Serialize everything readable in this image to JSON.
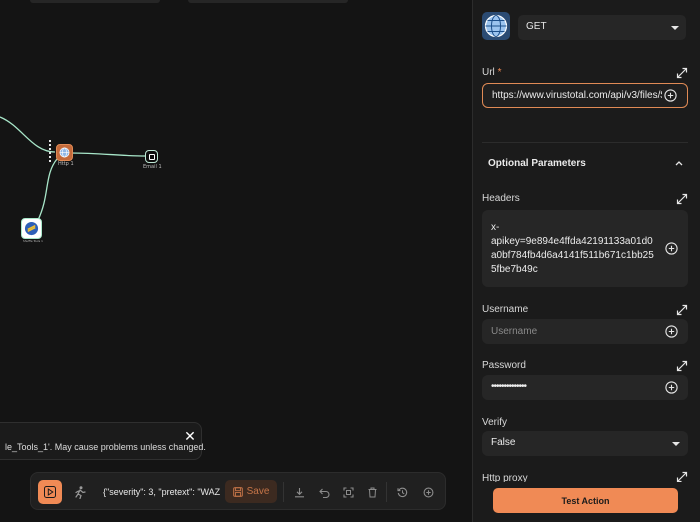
{
  "canvas": {
    "nodes": {
      "http": "Http 1",
      "email": "Email 1",
      "tools": "Shuffle Tools 1"
    }
  },
  "toast": {
    "message": "le_Tools_1'. May cause problems unless changed.",
    "close_icon": "close-icon"
  },
  "toolbar": {
    "execution_argument": "{\"severity\": 3, \"pretext\": \"WAZ",
    "save_label": "Save",
    "icons": [
      "play-icon",
      "run-icon",
      "save-icon",
      "download-icon",
      "undo-icon",
      "fit-view-icon",
      "delete-icon",
      "history-icon",
      "zoom-in-icon"
    ]
  },
  "panel": {
    "method": "GET",
    "url": {
      "label": "Url",
      "required_mark": "*",
      "value": "https://www.virustotal.com/api/v3/files/$"
    },
    "optional_title": "Optional Parameters",
    "headers": {
      "label": "Headers",
      "line1": "x-",
      "line2": "apikey=9e894e4ffda42191133a01d0",
      "line3": "a0bf784fb4d6a4141f511b671c1bb25",
      "line4": "5fbe7b49c"
    },
    "username": {
      "label": "Username",
      "placeholder": "Username"
    },
    "password": {
      "label": "Password",
      "value": "••••••••••••••"
    },
    "verify": {
      "label": "Verify",
      "value": "False"
    },
    "http_proxy": {
      "label": "Http proxy"
    },
    "test_action_label": "Test Action"
  },
  "colors": {
    "accent": "#f08a55",
    "edge": "#a8e6c9",
    "panel_bg": "#1b1b1b",
    "field_bg": "#262626",
    "canvas_bg": "#141414"
  }
}
